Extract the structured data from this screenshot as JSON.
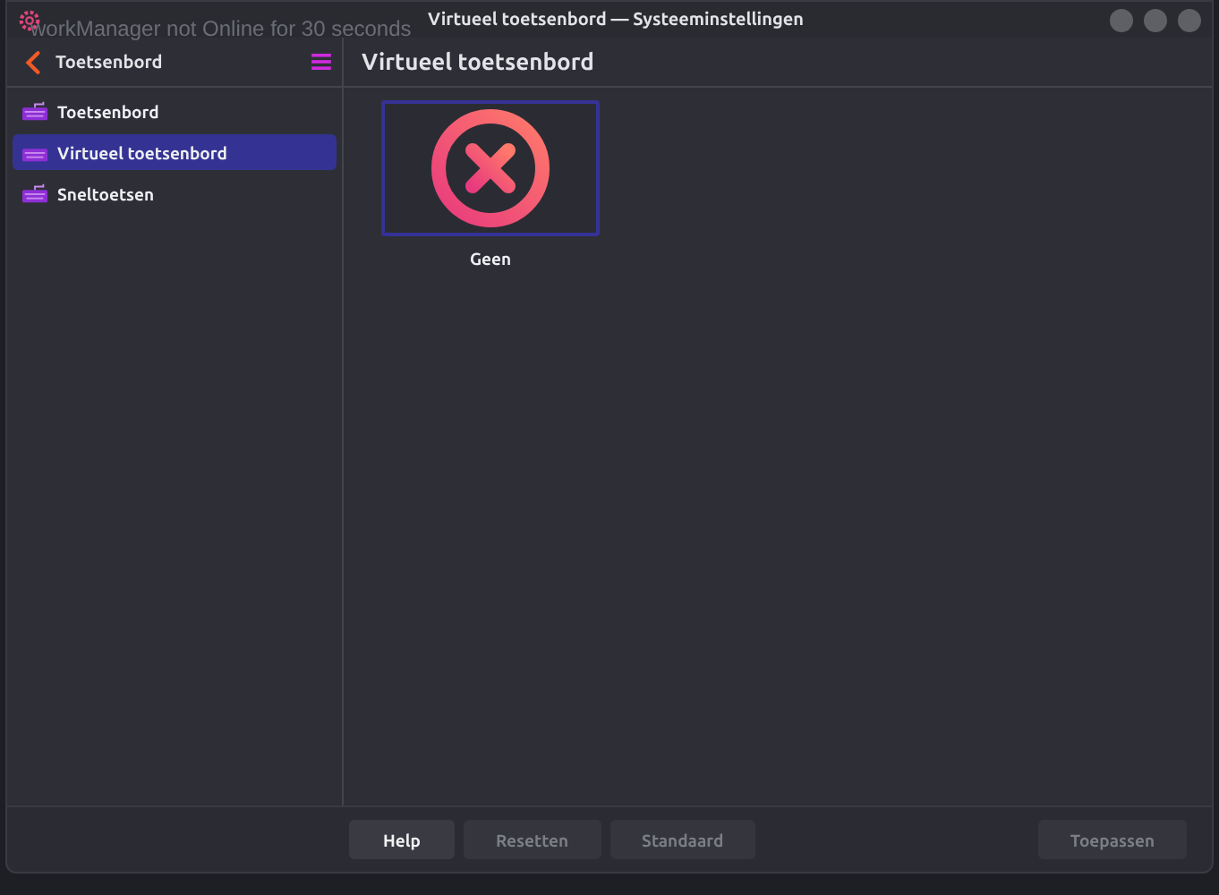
{
  "background_text": "workManager not Online for 30 seconds",
  "window": {
    "title": "Virtueel toetsenbord — Systeeminstellingen"
  },
  "sidebar": {
    "title": "Toetsenbord",
    "items": [
      {
        "label": "Toetsenbord",
        "selected": false
      },
      {
        "label": "Virtueel toetsenbord",
        "selected": true
      },
      {
        "label": "Sneltoetsen",
        "selected": false
      }
    ]
  },
  "page": {
    "title": "Virtueel toetsenbord",
    "options": [
      {
        "label": "Geen",
        "selected": true
      }
    ]
  },
  "buttons": [
    {
      "label": "Help",
      "disabled": false
    },
    {
      "label": "Resetten",
      "disabled": true
    },
    {
      "label": "Standaard",
      "disabled": true
    },
    {
      "label": "Toepassen",
      "disabled": true
    }
  ]
}
